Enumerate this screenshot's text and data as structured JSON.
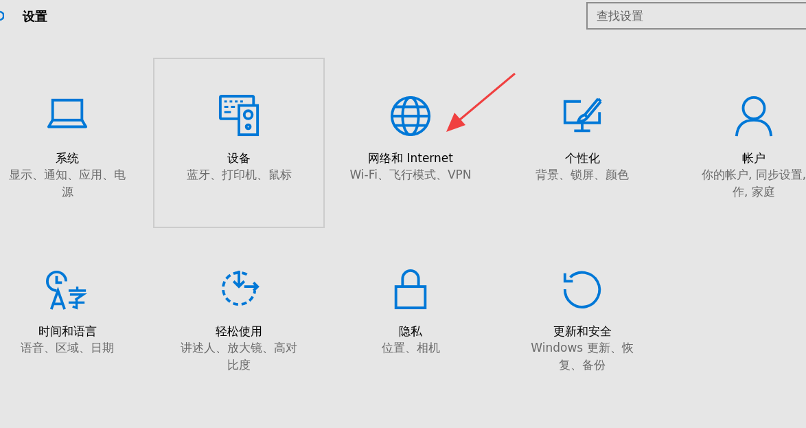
{
  "window": {
    "title": "设置"
  },
  "search": {
    "placeholder": "查找设置"
  },
  "tiles": [
    {
      "title": "系统",
      "description_lines": [
        "显示、通知、应用、电",
        "源"
      ],
      "selected": false
    },
    {
      "title": "设备",
      "description_lines": [
        "蓝牙、打印机、鼠标"
      ],
      "selected": true
    },
    {
      "title": "网络和 Internet",
      "description_lines": [
        "Wi-Fi、飞行模式、VPN"
      ],
      "selected": false
    },
    {
      "title": "个性化",
      "description_lines": [
        "背景、锁屏、颜色"
      ],
      "selected": false
    },
    {
      "title": "帐户",
      "description_lines": [
        "你的帐户, 同步设置,",
        "作, 家庭"
      ],
      "selected": false
    },
    {
      "title": "时间和语言",
      "description_lines": [
        "语音、区域、日期"
      ],
      "selected": false
    },
    {
      "title": "轻松使用",
      "description_lines": [
        "讲述人、放大镜、高对",
        "比度"
      ],
      "selected": false
    },
    {
      "title": "隐私",
      "description_lines": [
        "位置、相机"
      ],
      "selected": false
    },
    {
      "title": "更新和安全",
      "description_lines": [
        "Windows 更新、恢",
        "复、备份"
      ],
      "selected": false
    }
  ]
}
